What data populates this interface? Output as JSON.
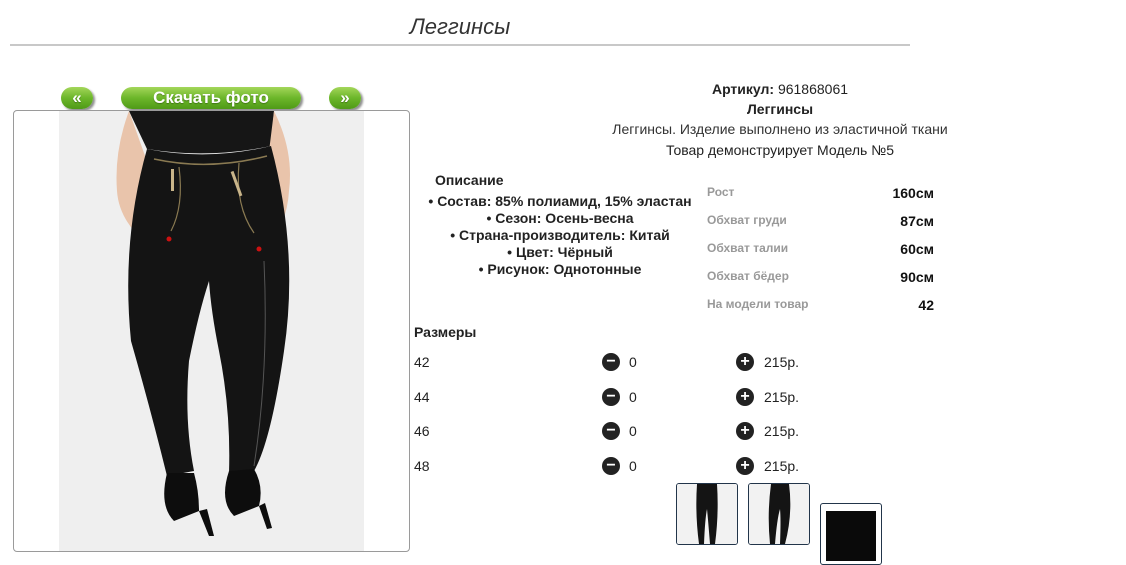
{
  "page": {
    "title": "Леггинсы"
  },
  "nav": {
    "prev_label": "«",
    "download_label": "Скачать фото",
    "next_label": "»"
  },
  "product": {
    "article_label": "Артикул:",
    "article_value": "961868061",
    "name": "Леггинсы",
    "short_description": "Леггинсы. Изделие выполнено из эластичной ткани",
    "model_note": "Товар демонструирует Модель №5"
  },
  "description": {
    "heading": "Описание",
    "items": [
      "Состав: 85% полиамид, 15% эластан",
      "Сезон: Осень-весна",
      "Страна-производитель: Китай",
      "Цвет: Чёрный",
      "Рисунок: Однотонные"
    ]
  },
  "measurements": [
    {
      "label": "Рост",
      "value": "160см"
    },
    {
      "label": "Обхват груди",
      "value": "87см"
    },
    {
      "label": "Обхват талии",
      "value": "60см"
    },
    {
      "label": "Обхват бёдер",
      "value": "90см"
    },
    {
      "label": "На модели товар",
      "value": "42"
    }
  ],
  "sizes": {
    "heading": "Размеры",
    "minus_icon": "−",
    "plus_icon": "+",
    "rows": [
      {
        "size": "42",
        "qty": "0",
        "price": "215р."
      },
      {
        "size": "44",
        "qty": "0",
        "price": "215р."
      },
      {
        "size": "46",
        "qty": "0",
        "price": "215р."
      },
      {
        "size": "48",
        "qty": "0",
        "price": "215р."
      }
    ]
  },
  "colors": {
    "button_green": "#6cb62a",
    "thumb_border": "#22354a",
    "legging": "#141414"
  }
}
